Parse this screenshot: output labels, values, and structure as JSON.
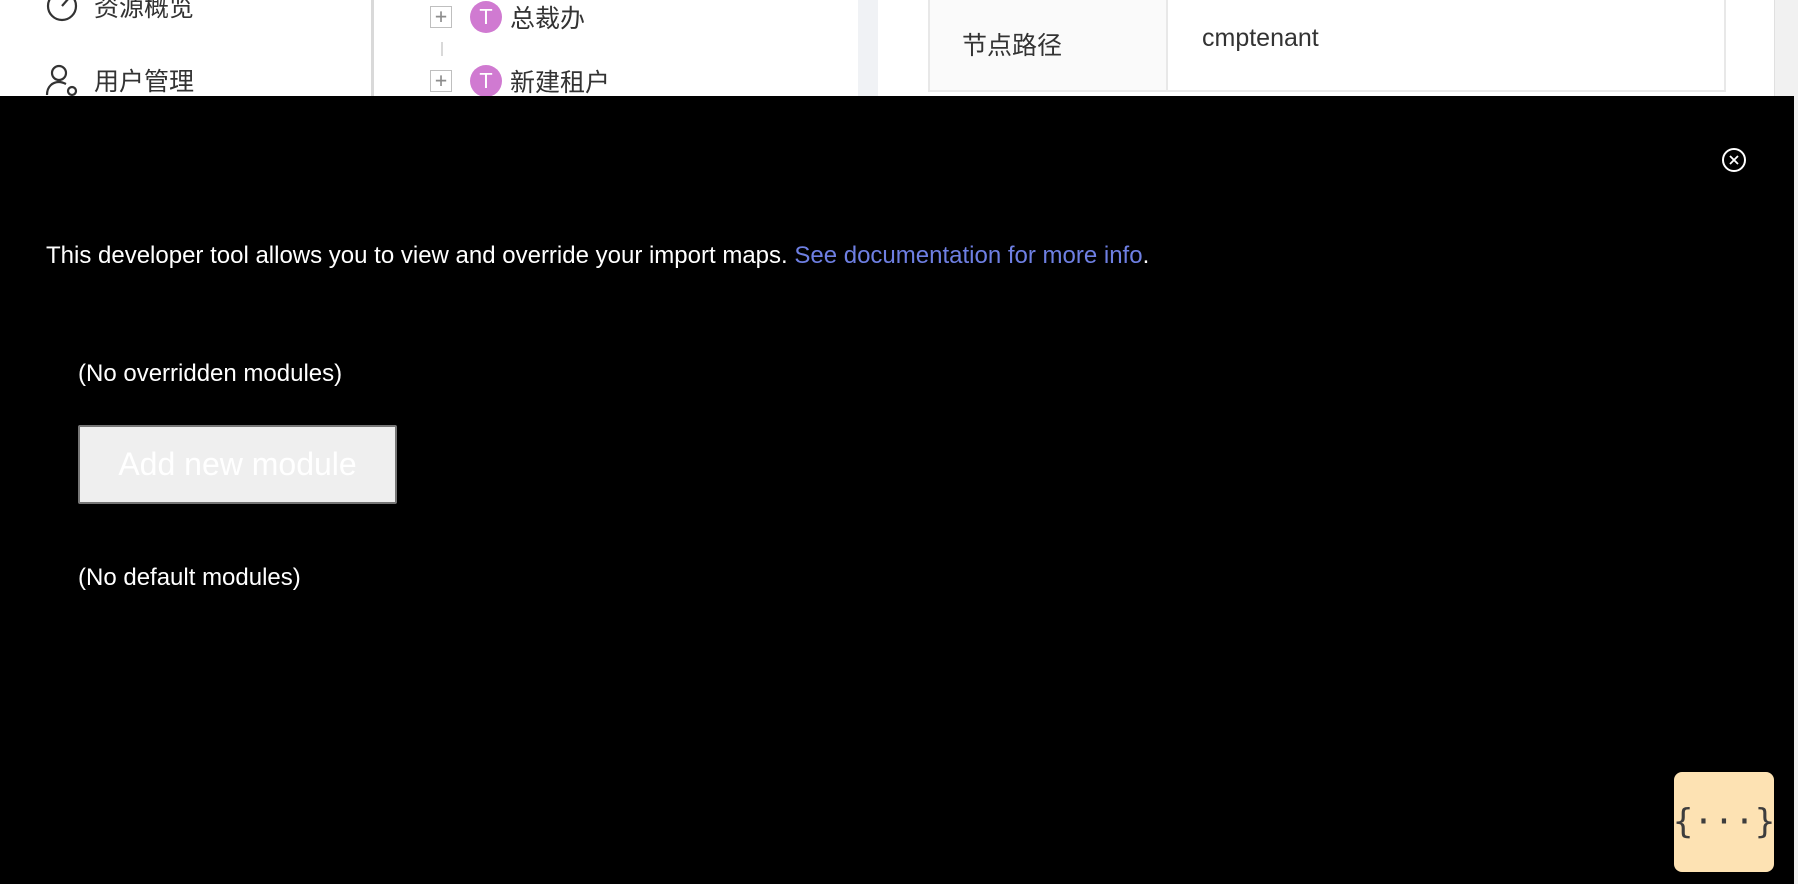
{
  "background_app": {
    "nav": {
      "items": [
        {
          "label": "资源概览",
          "icon": "dashboard-gauge-icon"
        },
        {
          "label": "用户管理",
          "icon": "user-settings-icon"
        }
      ]
    },
    "tree": {
      "nodes": [
        {
          "avatar": "T",
          "label": "总裁办",
          "expand_symbol": "+"
        },
        {
          "avatar": "T",
          "label": "新建租户",
          "expand_symbol": "+"
        }
      ]
    },
    "detail": {
      "rows": [
        {
          "key": "节点路径",
          "value": "cmptenant"
        }
      ]
    }
  },
  "devtools": {
    "intro_text": "This developer tool allows you to view and override your import maps. ",
    "doc_link_text": "See documentation for more info",
    "intro_suffix": ".",
    "no_overridden_text": "(No overridden modules)",
    "add_module_button": "Add new module",
    "no_default_text": "(No default modules)",
    "toggle_badge_text": "{···}",
    "close_icon": "close-circle-icon"
  },
  "colors": {
    "overlay_bg": "#000000",
    "link": "#6e7fe2",
    "avatar": "#d07ad1",
    "badge_bg": "#fde2b3"
  }
}
